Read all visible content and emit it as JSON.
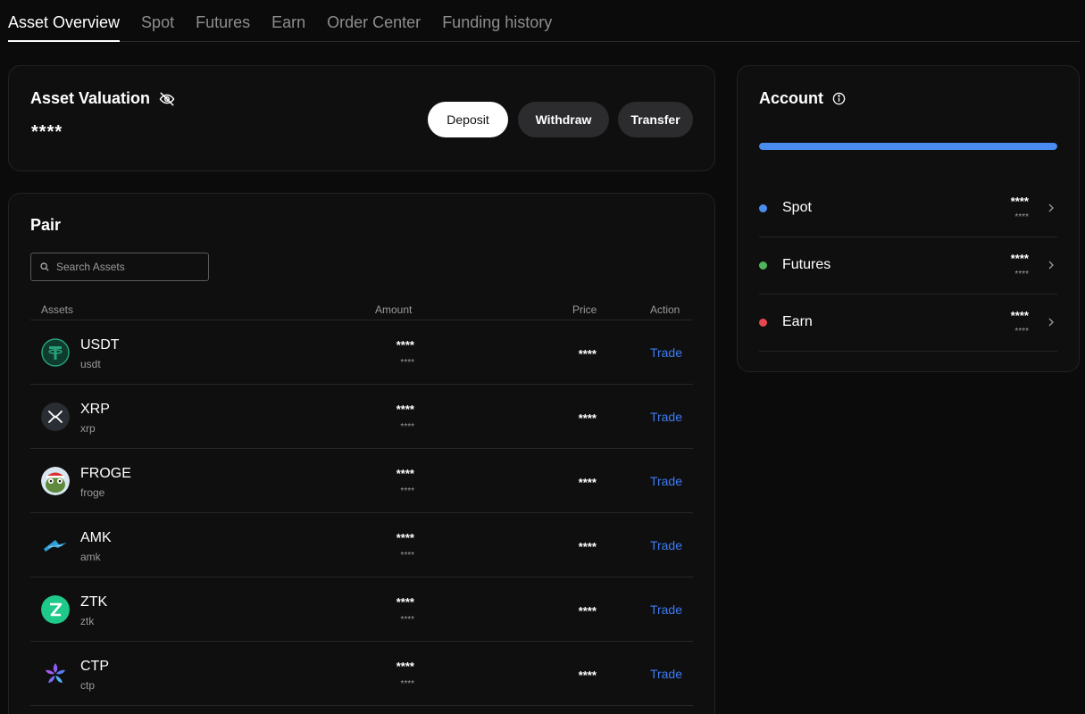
{
  "tabs": [
    {
      "label": "Asset Overview",
      "active": true
    },
    {
      "label": "Spot"
    },
    {
      "label": "Futures"
    },
    {
      "label": "Earn"
    },
    {
      "label": "Order Center"
    },
    {
      "label": "Funding history"
    }
  ],
  "valuation": {
    "title": "Asset Valuation",
    "hidden_icon": "eye-off-icon",
    "value": "****",
    "buttons": {
      "deposit": "Deposit",
      "withdraw": "Withdraw",
      "transfer": "Transfer"
    }
  },
  "pair": {
    "title": "Pair",
    "search": {
      "placeholder": "Search Assets",
      "value": ""
    },
    "columns": {
      "assets": "Assets",
      "amount": "Amount",
      "price": "Price",
      "action": "Action"
    },
    "rows": [
      {
        "symbol": "USDT",
        "name": "usdt",
        "amount": "****",
        "amount_sub": "****",
        "price": "****",
        "action": "Trade",
        "icon": "usdt-icon"
      },
      {
        "symbol": "XRP",
        "name": "xrp",
        "amount": "****",
        "amount_sub": "****",
        "price": "****",
        "action": "Trade",
        "icon": "xrp-icon"
      },
      {
        "symbol": "FROGE",
        "name": "froge",
        "amount": "****",
        "amount_sub": "****",
        "price": "****",
        "action": "Trade",
        "icon": "froge-icon"
      },
      {
        "symbol": "AMK",
        "name": "amk",
        "amount": "****",
        "amount_sub": "****",
        "price": "****",
        "action": "Trade",
        "icon": "amk-icon"
      },
      {
        "symbol": "ZTK",
        "name": "ztk",
        "amount": "****",
        "amount_sub": "****",
        "price": "****",
        "action": "Trade",
        "icon": "ztk-icon"
      },
      {
        "symbol": "CTP",
        "name": "ctp",
        "amount": "****",
        "amount_sub": "****",
        "price": "****",
        "action": "Trade",
        "icon": "ctp-icon"
      }
    ]
  },
  "account": {
    "title": "Account",
    "info_icon": "info-icon",
    "progress_fraction": 1.0,
    "items": [
      {
        "label": "Spot",
        "amount": "****",
        "amount_sub": "****",
        "color": "#4a8cf1"
      },
      {
        "label": "Futures",
        "amount": "****",
        "amount_sub": "****",
        "color": "#4fb45a"
      },
      {
        "label": "Earn",
        "amount": "****",
        "amount_sub": "****",
        "color": "#e5484d"
      }
    ]
  },
  "colors": {
    "accent": "#3d7cf5",
    "background": "#0b0b0b",
    "card": "#0f0f0f"
  }
}
